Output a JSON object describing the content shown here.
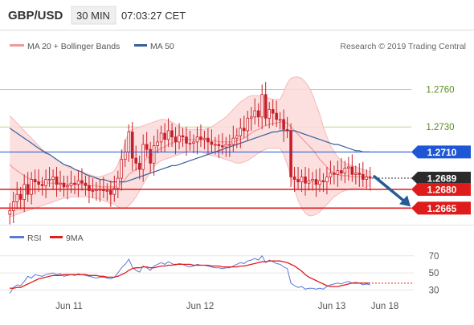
{
  "header": {
    "symbol": "GBP/USD",
    "timeframe": "30 MIN",
    "time": "07:03:27 CET"
  },
  "legend": {
    "bollinger": "MA 20 + Bollinger Bands",
    "ma50": "MA 50",
    "rsi": "RSI",
    "ma9": "9MA"
  },
  "credit": "Research © 2019 Trading Central",
  "colors": {
    "bull_candle": "#c81e28",
    "bear_candle": "#c81e28",
    "bollinger_band": "#fbdada",
    "ma20": "#f29a9a",
    "ma50": "#3a5f9b",
    "level_blue": "#1f56d6",
    "level_dark": "#2b2b2b",
    "level_red": "#e01b1b",
    "grid_green": "#b8d88a",
    "rsi_line": "#5a78d6",
    "rsi_ma": "#e01b1b",
    "arrow": "#235c96"
  },
  "chart_data": [
    {
      "type": "candlestick",
      "yaxis": {
        "ticks": [
          "1.2760",
          "1.2730"
        ]
      },
      "levels": [
        {
          "value": 1.271,
          "label": "1.2710",
          "kind": "resistance"
        },
        {
          "value": 1.2689,
          "label": "1.2689",
          "kind": "last_price"
        },
        {
          "value": 1.268,
          "label": "1.2680",
          "kind": "support"
        },
        {
          "value": 1.2665,
          "label": "1.2665",
          "kind": "support"
        }
      ],
      "ylim": [
        1.2653,
        1.2788
      ],
      "open": [
        1.266,
        1.2663,
        1.267,
        1.2676,
        1.2672,
        1.2684,
        1.2676,
        1.2688,
        1.2686,
        1.2684,
        1.2683,
        1.2688,
        1.2688,
        1.269,
        1.2684,
        1.2685,
        1.2682,
        1.2683,
        1.2685,
        1.2684,
        1.2687,
        1.2685,
        1.2683,
        1.2679,
        1.2679,
        1.268,
        1.268,
        1.2679,
        1.2679,
        1.2676,
        1.2681,
        1.2689,
        1.2704,
        1.271,
        1.2726,
        1.2705,
        1.2701,
        1.2696,
        1.2716,
        1.2712,
        1.2701,
        1.2715,
        1.2718,
        1.2725,
        1.272,
        1.2727,
        1.2722,
        1.2718,
        1.2723,
        1.2722,
        1.2717,
        1.2717,
        1.2718,
        1.2722,
        1.272,
        1.2721,
        1.2718,
        1.2716,
        1.2716,
        1.2715,
        1.2714,
        1.2716,
        1.2716,
        1.2721,
        1.2723,
        1.2729,
        1.2727,
        1.2737,
        1.2738,
        1.2743,
        1.2738,
        1.2756,
        1.2737,
        1.2744,
        1.2741,
        1.2736,
        1.2736,
        1.2728,
        1.2727,
        1.269,
        1.2688,
        1.2686,
        1.269,
        1.2685,
        1.2687,
        1.2688,
        1.2684,
        1.2687,
        1.2686,
        1.269,
        1.2693,
        1.2692,
        1.2695,
        1.2693,
        1.2697,
        1.2698,
        1.2692,
        1.2693,
        1.2692,
        1.2688,
        1.269
      ],
      "close": [
        1.2663,
        1.267,
        1.2676,
        1.2672,
        1.2684,
        1.2676,
        1.2688,
        1.2686,
        1.2684,
        1.2683,
        1.2688,
        1.2688,
        1.269,
        1.2684,
        1.2685,
        1.2682,
        1.2683,
        1.2685,
        1.2684,
        1.2687,
        1.2685,
        1.2683,
        1.2679,
        1.2679,
        1.268,
        1.268,
        1.2679,
        1.2679,
        1.2676,
        1.2681,
        1.2689,
        1.2704,
        1.271,
        1.2726,
        1.2705,
        1.2701,
        1.2696,
        1.2716,
        1.2712,
        1.2701,
        1.2715,
        1.2718,
        1.2725,
        1.272,
        1.2727,
        1.2722,
        1.2718,
        1.2723,
        1.2722,
        1.2717,
        1.2717,
        1.2718,
        1.2722,
        1.272,
        1.2721,
        1.2718,
        1.2716,
        1.2716,
        1.2715,
        1.2714,
        1.2716,
        1.2716,
        1.2721,
        1.2723,
        1.2729,
        1.2727,
        1.2737,
        1.2738,
        1.2743,
        1.2738,
        1.2756,
        1.2737,
        1.2744,
        1.2741,
        1.2736,
        1.2736,
        1.2728,
        1.2727,
        1.269,
        1.2688,
        1.2686,
        1.269,
        1.2685,
        1.2687,
        1.2688,
        1.2684,
        1.2687,
        1.2686,
        1.269,
        1.2693,
        1.2692,
        1.2695,
        1.2693,
        1.2697,
        1.2698,
        1.2692,
        1.2693,
        1.2692,
        1.2688,
        1.269,
        1.2689
      ],
      "ma20": [
        1.27,
        1.2697,
        1.2695,
        1.2693,
        1.2691,
        1.2689,
        1.2688,
        1.2687,
        1.2686,
        1.2686,
        1.2685,
        1.2685,
        1.2685,
        1.2685,
        1.2685,
        1.2685,
        1.2684,
        1.2684,
        1.2684,
        1.2684,
        1.2684,
        1.2684,
        1.2683,
        1.2683,
        1.2683,
        1.2682,
        1.2682,
        1.2682,
        1.2682,
        1.2682,
        1.2683,
        1.2685,
        1.2688,
        1.2692,
        1.2694,
        1.2696,
        1.2698,
        1.2702,
        1.2705,
        1.2706,
        1.2709,
        1.2711,
        1.2713,
        1.2714,
        1.2716,
        1.2717,
        1.2718,
        1.2719,
        1.272,
        1.272,
        1.272,
        1.272,
        1.272,
        1.272,
        1.272,
        1.272,
        1.2719,
        1.2719,
        1.2718,
        1.2718,
        1.2718,
        1.2718,
        1.2718,
        1.2719,
        1.272,
        1.2721,
        1.2723,
        1.2725,
        1.2727,
        1.2728,
        1.273,
        1.2731,
        1.2732,
        1.2733,
        1.2733,
        1.2734,
        1.2734,
        1.2733,
        1.273,
        1.2727,
        1.2724,
        1.2721,
        1.2718,
        1.2715,
        1.2712,
        1.2708,
        1.2704,
        1.2701,
        1.2698,
        1.2695,
        1.2693,
        1.2692,
        1.2691,
        1.2691,
        1.2691,
        1.269,
        1.269,
        1.269,
        1.269,
        1.269,
        1.269
      ],
      "ma50": [
        1.2729,
        1.2727,
        1.2725,
        1.2723,
        1.2721,
        1.2719,
        1.2717,
        1.2715,
        1.2713,
        1.2711,
        1.2709,
        1.2708,
        1.2706,
        1.2704,
        1.2702,
        1.27,
        1.2699,
        1.2698,
        1.2696,
        1.2695,
        1.2694,
        1.2692,
        1.2691,
        1.269,
        1.2689,
        1.2688,
        1.2688,
        1.2687,
        1.2686,
        1.2686,
        1.2686,
        1.2686,
        1.2686,
        1.2687,
        1.2688,
        1.2689,
        1.269,
        1.2691,
        1.2692,
        1.2693,
        1.2694,
        1.2695,
        1.2696,
        1.2697,
        1.2698,
        1.2699,
        1.2699,
        1.27,
        1.2701,
        1.2702,
        1.2703,
        1.2704,
        1.2705,
        1.2706,
        1.2707,
        1.2708,
        1.2709,
        1.271,
        1.2711,
        1.2712,
        1.2713,
        1.2714,
        1.2715,
        1.2716,
        1.2717,
        1.2718,
        1.2719,
        1.272,
        1.2721,
        1.2722,
        1.2723,
        1.2724,
        1.2725,
        1.2726,
        1.2726,
        1.2727,
        1.2727,
        1.2727,
        1.2727,
        1.2727,
        1.2726,
        1.2725,
        1.2724,
        1.2723,
        1.2722,
        1.2721,
        1.272,
        1.2719,
        1.2718,
        1.2717,
        1.2716,
        1.2716,
        1.2715,
        1.2714,
        1.2713,
        1.2712,
        1.2711,
        1.2711,
        1.271,
        1.271,
        1.271
      ],
      "bb_upper": [
        1.2739,
        1.2736,
        1.2733,
        1.273,
        1.2727,
        1.2724,
        1.2721,
        1.2718,
        1.2715,
        1.2712,
        1.271,
        1.2708,
        1.2706,
        1.2704,
        1.2702,
        1.27,
        1.2698,
        1.2697,
        1.2696,
        1.2695,
        1.2694,
        1.2693,
        1.2692,
        1.2691,
        1.269,
        1.269,
        1.2691,
        1.2692,
        1.2693,
        1.2695,
        1.27,
        1.2708,
        1.2718,
        1.2726,
        1.2728,
        1.2729,
        1.273,
        1.2731,
        1.2732,
        1.2733,
        1.2734,
        1.2735,
        1.2736,
        1.2736,
        1.2735,
        1.2734,
        1.2732,
        1.273,
        1.2729,
        1.2728,
        1.2728,
        1.2728,
        1.2728,
        1.2728,
        1.2728,
        1.2729,
        1.273,
        1.2732,
        1.2734,
        1.2736,
        1.2738,
        1.2741,
        1.2744,
        1.2747,
        1.275,
        1.2752,
        1.2754,
        1.2755,
        1.2755,
        1.2755,
        1.2755,
        1.2754,
        1.2753,
        1.2752,
        1.2752,
        1.2752,
        1.2758,
        1.2765,
        1.2769,
        1.277,
        1.277,
        1.2769,
        1.2766,
        1.2762,
        1.2756,
        1.2748,
        1.274,
        1.273,
        1.2722,
        1.2715,
        1.271,
        1.2706,
        1.2703,
        1.2701,
        1.27,
        1.2699,
        1.2698,
        1.2697,
        1.2696,
        1.2695,
        1.2694
      ],
      "bb_lower": [
        1.2658,
        1.2659,
        1.266,
        1.2661,
        1.2662,
        1.2663,
        1.2664,
        1.2665,
        1.2666,
        1.2667,
        1.2668,
        1.2669,
        1.267,
        1.2671,
        1.2672,
        1.2673,
        1.2673,
        1.2674,
        1.2674,
        1.2674,
        1.2674,
        1.2674,
        1.2674,
        1.2673,
        1.2673,
        1.2672,
        1.2671,
        1.267,
        1.2669,
        1.2668,
        1.2666,
        1.2665,
        1.2665,
        1.2667,
        1.267,
        1.2674,
        1.2679,
        1.2684,
        1.2689,
        1.2694,
        1.2698,
        1.2701,
        1.2703,
        1.2704,
        1.2705,
        1.2706,
        1.2707,
        1.2708,
        1.2709,
        1.271,
        1.271,
        1.271,
        1.271,
        1.271,
        1.2709,
        1.2708,
        1.2707,
        1.2707,
        1.2706,
        1.2705,
        1.2704,
        1.2703,
        1.2702,
        1.2701,
        1.2701,
        1.2702,
        1.2703,
        1.2705,
        1.2707,
        1.2709,
        1.2711,
        1.2712,
        1.2713,
        1.2713,
        1.2713,
        1.2713,
        1.2708,
        1.27,
        1.269,
        1.268,
        1.2671,
        1.2665,
        1.2661,
        1.2659,
        1.2659,
        1.266,
        1.2662,
        1.2665,
        1.2668,
        1.2671,
        1.2674,
        1.2676,
        1.2678,
        1.2679,
        1.268,
        1.2681,
        1.2681,
        1.2681,
        1.2681,
        1.2682,
        1.2683
      ],
      "forecast_arrow": {
        "from": 1.2689,
        "to": 1.2665
      }
    },
    {
      "type": "line",
      "name": "RSI",
      "yaxis": {
        "ticks": [
          "70",
          "50",
          "30"
        ]
      },
      "ylim": [
        20,
        82
      ],
      "xaxis": {
        "ticks": [
          "Jun 11",
          "Jun 12",
          "Jun 13",
          "Jun 18"
        ]
      },
      "series": [
        {
          "name": "RSI",
          "values": [
            26,
            33,
            36,
            35,
            40,
            46,
            44,
            48,
            47,
            46,
            48,
            49,
            50,
            48,
            49,
            46,
            47,
            48,
            47,
            49,
            48,
            47,
            46,
            45,
            44,
            45,
            45,
            44,
            43,
            45,
            50,
            56,
            60,
            66,
            57,
            53,
            51,
            58,
            56,
            53,
            58,
            60,
            62,
            60,
            63,
            61,
            59,
            61,
            60,
            58,
            57,
            58,
            60,
            59,
            59,
            58,
            57,
            56,
            56,
            55,
            56,
            56,
            58,
            60,
            62,
            61,
            64,
            65,
            67,
            65,
            70,
            62,
            65,
            63,
            61,
            60,
            57,
            55,
            38,
            35,
            33,
            34,
            31,
            32,
            32,
            31,
            32,
            31,
            34,
            36,
            37,
            38,
            37,
            39,
            40,
            38,
            39,
            38,
            36,
            37,
            36
          ]
        },
        {
          "name": "9MA",
          "values": [
            32,
            32,
            33,
            33,
            35,
            37,
            39,
            41,
            43,
            44,
            45,
            46,
            47,
            47,
            47,
            48,
            48,
            48,
            48,
            48,
            48,
            48,
            47,
            47,
            47,
            46,
            46,
            45,
            45,
            45,
            46,
            48,
            50,
            53,
            55,
            56,
            56,
            57,
            57,
            56,
            56,
            57,
            58,
            58,
            59,
            59,
            60,
            60,
            60,
            60,
            60,
            59,
            59,
            59,
            59,
            59,
            58,
            58,
            58,
            57,
            57,
            57,
            57,
            57,
            58,
            58,
            59,
            60,
            61,
            62,
            63,
            63,
            64,
            64,
            64,
            64,
            63,
            62,
            60,
            58,
            55,
            52,
            48,
            45,
            43,
            41,
            39,
            37,
            35,
            34,
            34,
            34,
            35,
            36,
            37,
            38,
            38,
            38,
            38,
            38,
            38
          ]
        }
      ]
    }
  ]
}
